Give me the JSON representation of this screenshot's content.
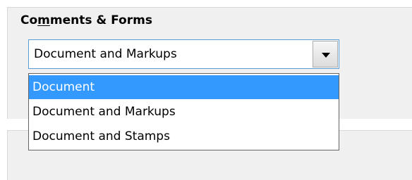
{
  "group": {
    "label_before": "Co",
    "label_mnemonic": "m",
    "label_after": "ments & Forms"
  },
  "combo": {
    "selected_value": "Document and Markups"
  },
  "dropdown": {
    "options": [
      {
        "label": "Document",
        "highlighted": true
      },
      {
        "label": "Document and Markups",
        "highlighted": false
      },
      {
        "label": "Document and Stamps",
        "highlighted": false
      }
    ]
  },
  "colors": {
    "highlight": "#3399ff",
    "combo_border": "#5b9bd5",
    "panel_background": "#f0f0f0"
  },
  "icons": {
    "combo_arrow": "chevron-down-icon"
  }
}
